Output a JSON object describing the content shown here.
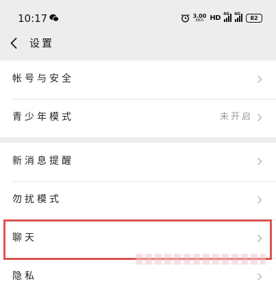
{
  "status_bar": {
    "time": "10:17",
    "net_speed_value": "3.00",
    "net_speed_unit": "KB/S",
    "hd_label": "HD",
    "signal1_label": "4G",
    "signal2_label": "4G",
    "battery": "82"
  },
  "header": {
    "title": "设置"
  },
  "settings": {
    "group1": [
      {
        "label": "帐号与安全",
        "value": ""
      },
      {
        "label": "青少年模式",
        "value": "未开启"
      }
    ],
    "group2": [
      {
        "label": "新消息提醒",
        "value": ""
      },
      {
        "label": "勿扰模式",
        "value": ""
      },
      {
        "label": "聊天",
        "value": ""
      },
      {
        "label": "隐私",
        "value": ""
      }
    ]
  },
  "colors": {
    "background": "#ededed",
    "panel": "#ffffff",
    "highlight": "#d9534f",
    "secondary_text": "#9a9a9a"
  },
  "icons": {
    "back": "chevron-left-icon",
    "row_arrow": "chevron-right-icon",
    "status_app": "wechat-icon",
    "alarm": "alarm-clock-icon"
  }
}
